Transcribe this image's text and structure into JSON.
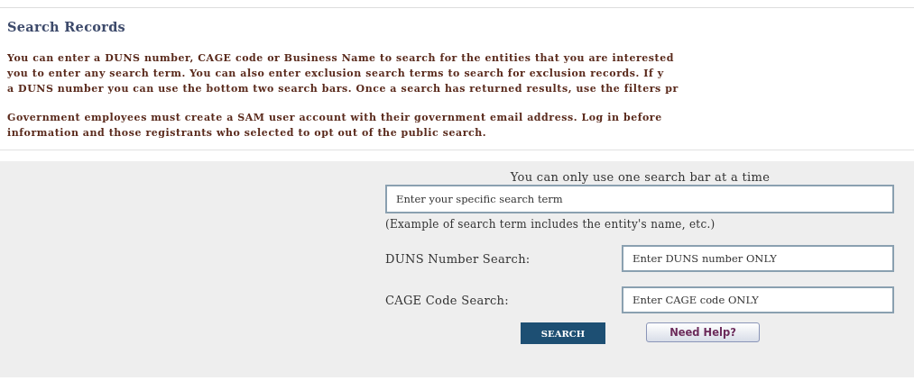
{
  "title": "Search Records",
  "paragraphs": [
    [
      "You can enter a DUNS number, CAGE code or Business Name to search for the entities that you are interested",
      "you to enter any search term. You can also enter exclusion search terms to search for exclusion records. If y",
      "a DUNS number you can use the bottom two search bars. Once a search has returned results, use the filters pr"
    ],
    [
      "Government employees must create a SAM user account with their government email address. Log in before",
      "information and those registrants who selected to opt out of the public search."
    ]
  ],
  "form": {
    "notice": "You can only use one search bar at a time",
    "term_field": {
      "placeholder": "Enter your specific search term"
    },
    "example": "(Example of search term includes the entity's name, etc.)",
    "fields": [
      {
        "label": "DUNS Number Search:",
        "placeholder": "Enter DUNS number ONLY"
      },
      {
        "label": "CAGE Code Search:",
        "placeholder": "Enter CAGE code ONLY"
      }
    ],
    "buttons": [
      {
        "label": "SEARCH",
        "kind": "primary"
      },
      {
        "label": "Need Help?",
        "kind": "secondary"
      }
    ]
  }
}
